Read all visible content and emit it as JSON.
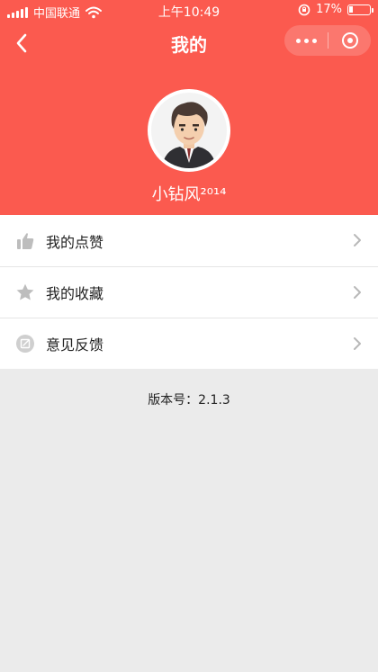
{
  "status_bar": {
    "carrier": "中国联通",
    "time": "上午10:49",
    "battery_percent": "17%",
    "battery_level": 0.17
  },
  "nav": {
    "title": "我的",
    "back_icon": "chevron-left-icon",
    "more_icon": "more-dots-icon",
    "close_icon": "target-icon"
  },
  "profile": {
    "username": "小钻风²⁰¹⁴"
  },
  "menu": {
    "items": [
      {
        "label": "我的点赞",
        "icon": "thumbs-up-icon"
      },
      {
        "label": "我的收藏",
        "icon": "star-icon"
      },
      {
        "label": "意见反馈",
        "icon": "feedback-edit-icon"
      }
    ]
  },
  "footer": {
    "version_text": "版本号：2.1.3"
  },
  "colors": {
    "header_bg": "#fb5a4f",
    "page_bg": "#ebebeb",
    "icon_gray": "#bdbdbd"
  }
}
